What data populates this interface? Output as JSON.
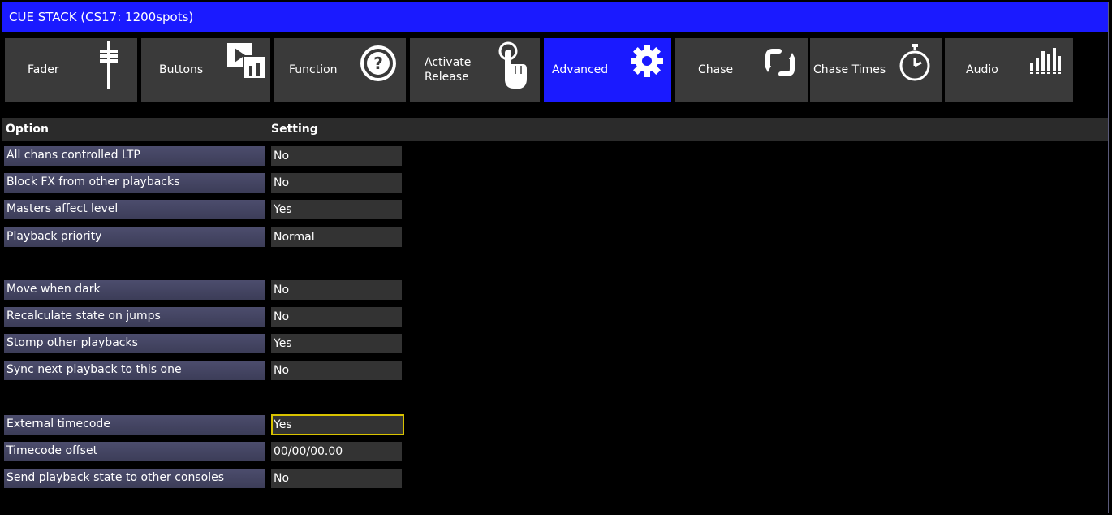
{
  "window": {
    "title": "CUE STACK (CS17: 1200spots)"
  },
  "tabs": [
    {
      "label": "Fader",
      "icon": "fader-icon"
    },
    {
      "label": "Buttons",
      "icon": "buttons-icon"
    },
    {
      "label": "Function",
      "icon": "question-icon"
    },
    {
      "label": "Activate\nRelease",
      "icon": "hand-pointer-icon"
    },
    {
      "label": "Advanced",
      "icon": "gear-icon",
      "active": true
    },
    {
      "label": "Chase",
      "icon": "chase-loop-icon"
    },
    {
      "label": "Chase Times",
      "icon": "stopwatch-icon"
    },
    {
      "label": "Audio",
      "icon": "audio-bars-icon"
    }
  ],
  "table": {
    "col_option": "Option",
    "col_setting": "Setting",
    "rows": [
      {
        "option": "All chans controlled LTP",
        "value": "No"
      },
      {
        "option": "Block FX from other playbacks",
        "value": "No"
      },
      {
        "option": "Masters affect level",
        "value": "Yes"
      },
      {
        "option": "Playback priority",
        "value": "Normal"
      },
      {
        "option": "Move when dark",
        "value": "No"
      },
      {
        "option": "Recalculate state on jumps",
        "value": "No"
      },
      {
        "option": "Stomp other playbacks",
        "value": "Yes"
      },
      {
        "option": "Sync next playback to this one",
        "value": "No"
      },
      {
        "option": "External timecode",
        "value": "Yes",
        "selected": true
      },
      {
        "option": "Timecode offset",
        "value": "00/00/00.00"
      },
      {
        "option": "Send playback state to other consoles",
        "value": "No"
      }
    ]
  },
  "colors": {
    "accent": "#1a1aff",
    "tab_bg": "#3a3a3a",
    "option_bg": "#44455f",
    "value_bg": "#333333",
    "selection_border": "#d8c200"
  }
}
